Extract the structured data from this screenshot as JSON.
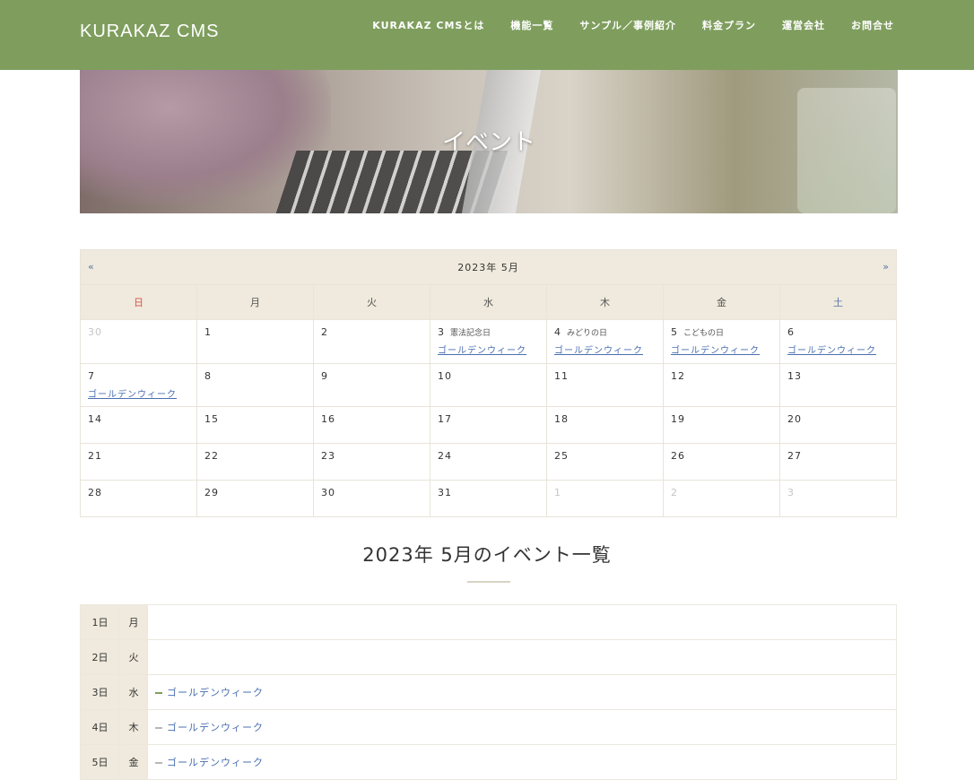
{
  "header": {
    "logo": "KURAKAZ CMS",
    "nav": [
      "KURAKAZ CMSとは",
      "機能一覧",
      "サンプル／事例紹介",
      "料金プラン",
      "運営会社",
      "お問合せ"
    ]
  },
  "hero": {
    "title": "イベント"
  },
  "calendar": {
    "prev": "«",
    "next": "»",
    "month_label": "2023年 5月",
    "weekdays": [
      "日",
      "月",
      "火",
      "水",
      "木",
      "金",
      "土"
    ],
    "weeks": [
      [
        {
          "num": "30",
          "other": true,
          "hol": "",
          "ev": ""
        },
        {
          "num": "1",
          "other": false,
          "hol": "",
          "ev": ""
        },
        {
          "num": "2",
          "other": false,
          "hol": "",
          "ev": ""
        },
        {
          "num": "3",
          "other": false,
          "hol": "憲法記念日",
          "ev": "ゴールデンウィーク"
        },
        {
          "num": "4",
          "other": false,
          "hol": "みどりの日",
          "ev": "ゴールデンウィーク"
        },
        {
          "num": "5",
          "other": false,
          "hol": "こどもの日",
          "ev": "ゴールデンウィーク"
        },
        {
          "num": "6",
          "other": false,
          "hol": "",
          "ev": "ゴールデンウィーク"
        }
      ],
      [
        {
          "num": "7",
          "other": false,
          "hol": "",
          "ev": "ゴールデンウィーク"
        },
        {
          "num": "8",
          "other": false,
          "hol": "",
          "ev": ""
        },
        {
          "num": "9",
          "other": false,
          "hol": "",
          "ev": ""
        },
        {
          "num": "10",
          "other": false,
          "hol": "",
          "ev": ""
        },
        {
          "num": "11",
          "other": false,
          "hol": "",
          "ev": ""
        },
        {
          "num": "12",
          "other": false,
          "hol": "",
          "ev": ""
        },
        {
          "num": "13",
          "other": false,
          "hol": "",
          "ev": ""
        }
      ],
      [
        {
          "num": "14",
          "other": false,
          "hol": "",
          "ev": ""
        },
        {
          "num": "15",
          "other": false,
          "hol": "",
          "ev": ""
        },
        {
          "num": "16",
          "other": false,
          "hol": "",
          "ev": ""
        },
        {
          "num": "17",
          "other": false,
          "hol": "",
          "ev": ""
        },
        {
          "num": "18",
          "other": false,
          "hol": "",
          "ev": ""
        },
        {
          "num": "19",
          "other": false,
          "hol": "",
          "ev": ""
        },
        {
          "num": "20",
          "other": false,
          "hol": "",
          "ev": ""
        }
      ],
      [
        {
          "num": "21",
          "other": false,
          "hol": "",
          "ev": ""
        },
        {
          "num": "22",
          "other": false,
          "hol": "",
          "ev": ""
        },
        {
          "num": "23",
          "other": false,
          "hol": "",
          "ev": ""
        },
        {
          "num": "24",
          "other": false,
          "hol": "",
          "ev": ""
        },
        {
          "num": "25",
          "other": false,
          "hol": "",
          "ev": ""
        },
        {
          "num": "26",
          "other": false,
          "hol": "",
          "ev": ""
        },
        {
          "num": "27",
          "other": false,
          "hol": "",
          "ev": ""
        }
      ],
      [
        {
          "num": "28",
          "other": false,
          "hol": "",
          "ev": ""
        },
        {
          "num": "29",
          "other": false,
          "hol": "",
          "ev": ""
        },
        {
          "num": "30",
          "other": false,
          "hol": "",
          "ev": ""
        },
        {
          "num": "31",
          "other": false,
          "hol": "",
          "ev": ""
        },
        {
          "num": "1",
          "other": true,
          "hol": "",
          "ev": ""
        },
        {
          "num": "2",
          "other": true,
          "hol": "",
          "ev": ""
        },
        {
          "num": "3",
          "other": true,
          "hol": "",
          "ev": ""
        }
      ]
    ]
  },
  "event_list": {
    "title": "2023年 5月のイベント一覧",
    "rows": [
      {
        "date": "1日",
        "wd": "月",
        "event": ""
      },
      {
        "date": "2日",
        "wd": "火",
        "event": ""
      },
      {
        "date": "3日",
        "wd": "水",
        "event": "ゴールデンウィーク"
      },
      {
        "date": "4日",
        "wd": "木",
        "event": "ゴールデンウィーク"
      },
      {
        "date": "5日",
        "wd": "金",
        "event": "ゴールデンウィーク"
      }
    ]
  },
  "colors": {
    "header_bg": "#7f9e5e",
    "cal_bg": "#efeadd",
    "link": "#4a6fb0",
    "sunday": "#d9534f",
    "saturday": "#5a72a8"
  }
}
